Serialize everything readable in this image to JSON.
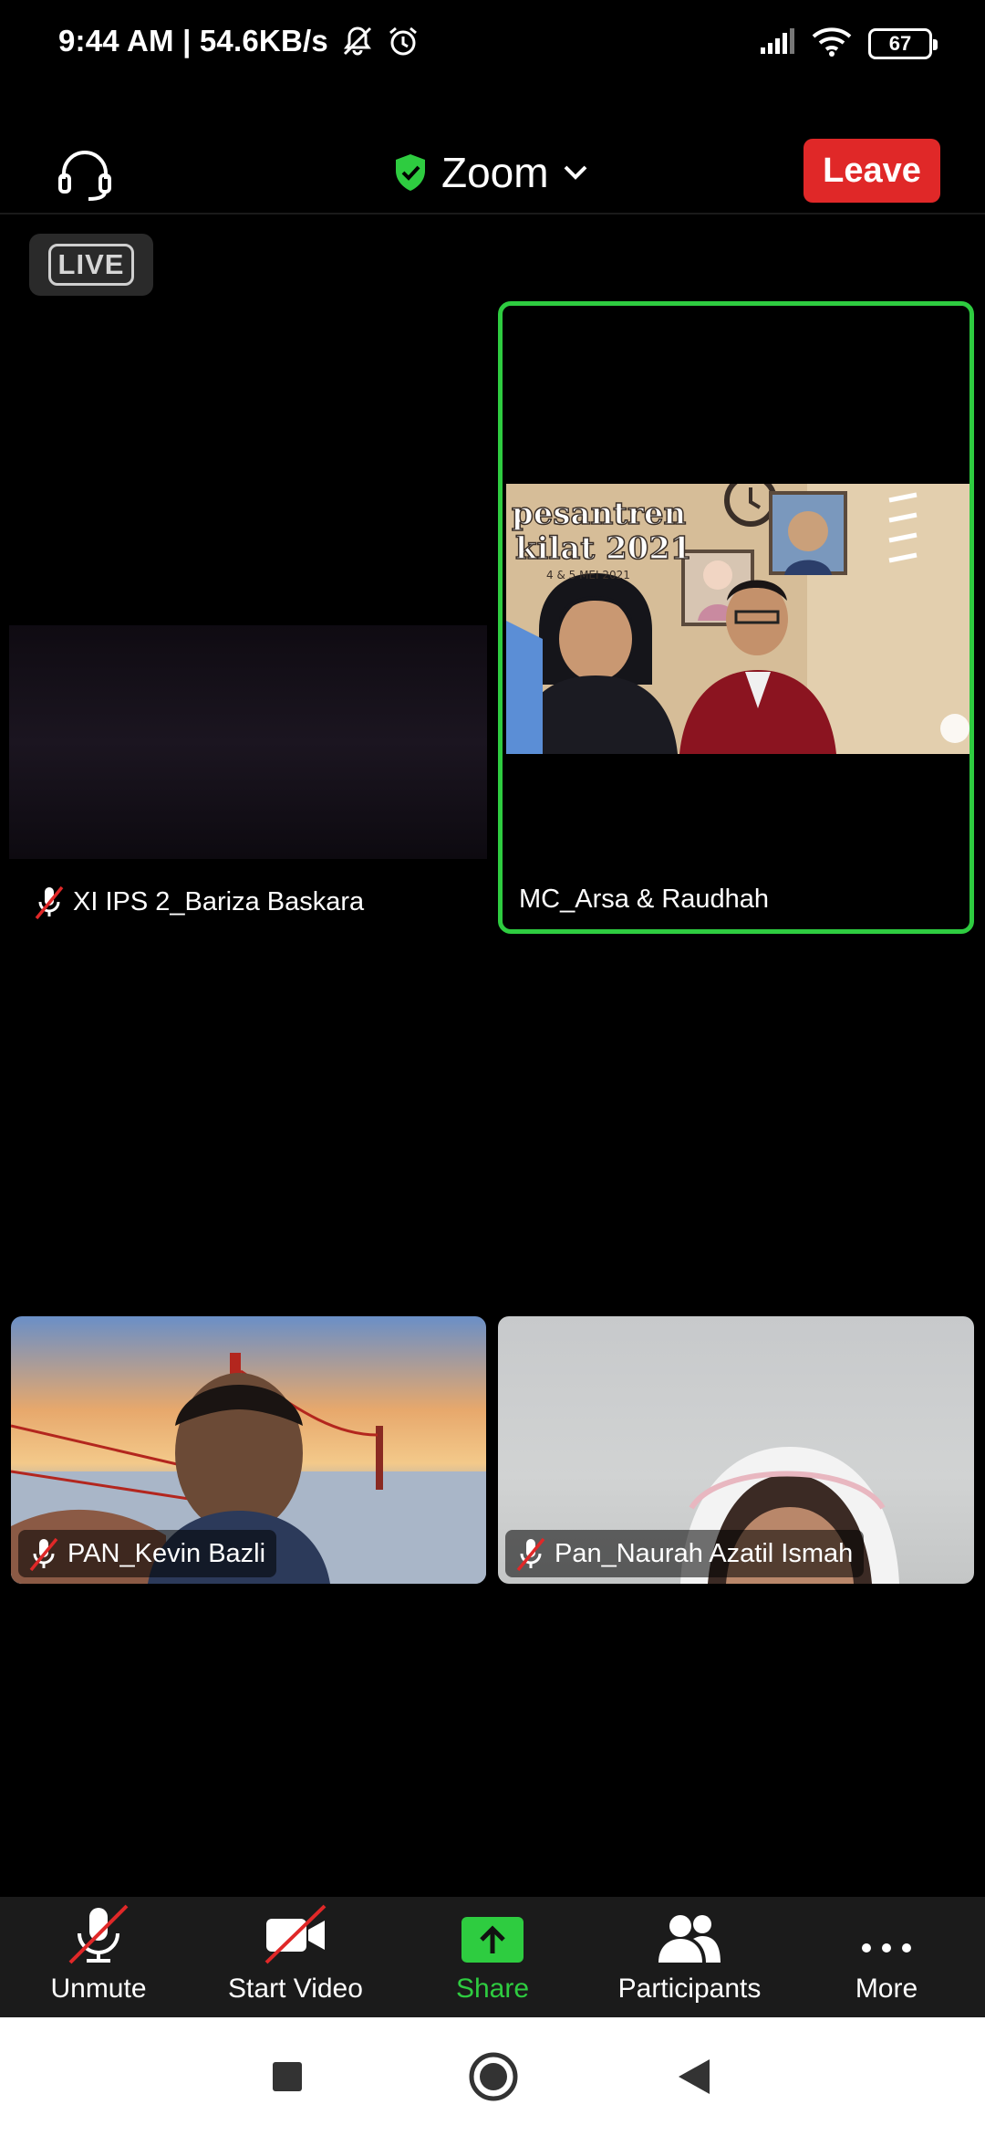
{
  "status_bar": {
    "time_speed": "9:44 AM | 54.6KB/s",
    "battery": "67"
  },
  "top_bar": {
    "title": "Zoom",
    "leave_label": "Leave"
  },
  "live_badge": "LIVE",
  "video_grid": {
    "tiles": [
      {
        "name": "XI IPS 2_Bariza Baskara",
        "muted": true,
        "active_speaker": false
      },
      {
        "name": "MC_Arsa & Raudhah",
        "muted": false,
        "active_speaker": true
      },
      {
        "name": "PAN_Kevin Bazli",
        "muted": true,
        "active_speaker": false
      },
      {
        "name": "Pan_Naurah Azatil Ismah",
        "muted": true,
        "active_speaker": false
      }
    ],
    "shared_banner": {
      "line1": "pesantren",
      "line2": "kilat 2021",
      "date": "4 & 5 MEI 2021"
    }
  },
  "toolbar": {
    "items": [
      {
        "label": "Unmute",
        "icon": "mic-off-icon"
      },
      {
        "label": "Start Video",
        "icon": "video-off-icon"
      },
      {
        "label": "Share",
        "icon": "share-upload-icon"
      },
      {
        "label": "Participants",
        "icon": "participants-icon"
      },
      {
        "label": "More",
        "icon": "more-dots-icon"
      }
    ]
  },
  "colors": {
    "leave_red": "#e02828",
    "active_green": "#2ecc40",
    "toolbar_bg": "#1b1b1b"
  }
}
